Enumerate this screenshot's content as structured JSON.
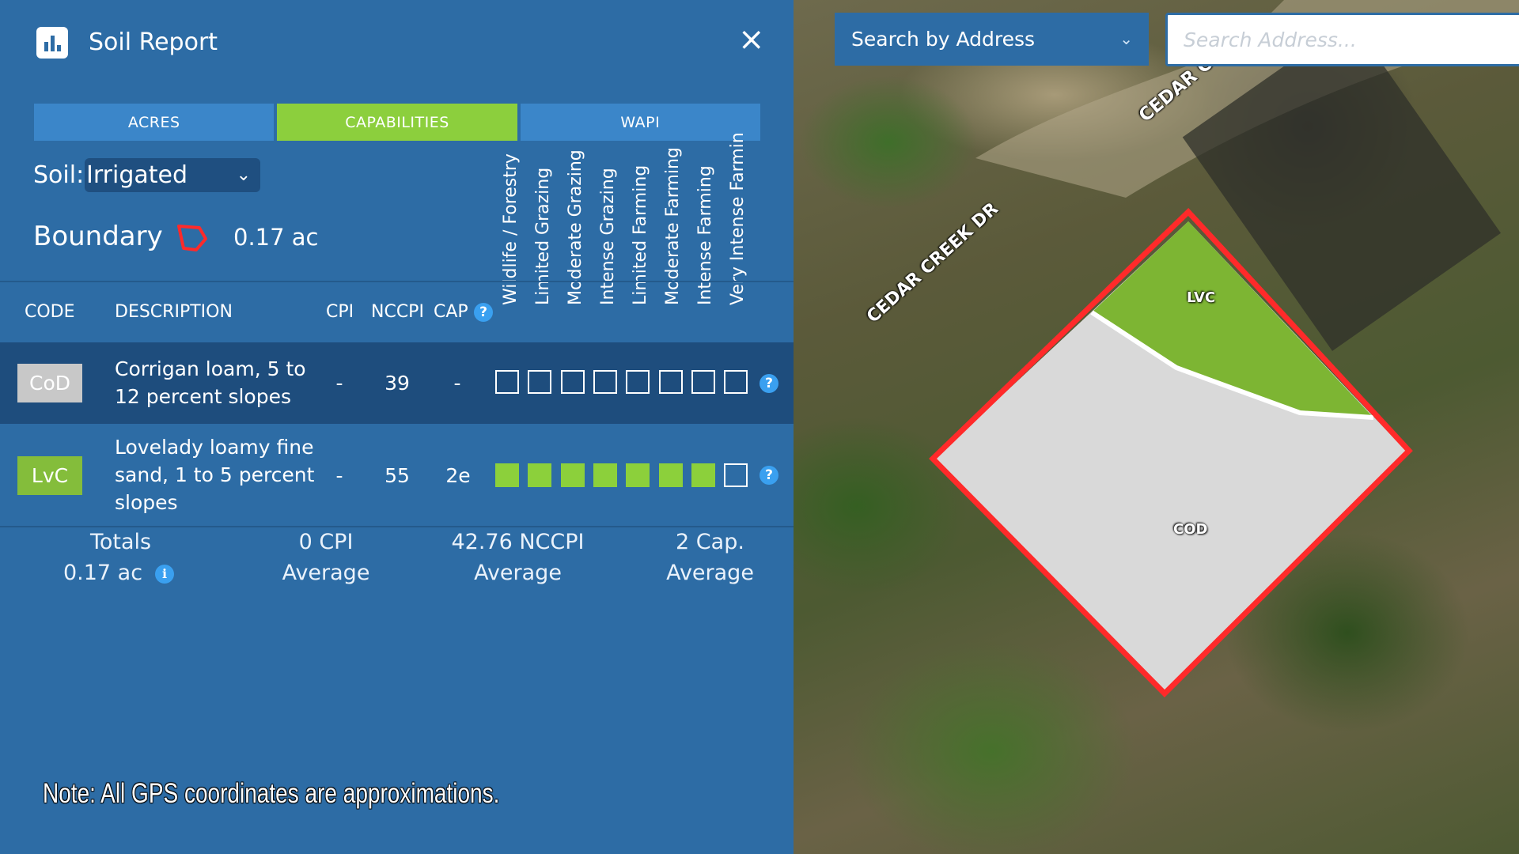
{
  "header": {
    "title": "Soil Report",
    "close_label": "×"
  },
  "tabs": [
    {
      "label": "ACRES",
      "active": false
    },
    {
      "label": "CAPABILITIES",
      "active": true
    },
    {
      "label": "WAPI",
      "active": false
    }
  ],
  "soil": {
    "label": "Soil:",
    "selected": "Irrigated"
  },
  "boundary": {
    "label": "Boundary",
    "value": "0.17 ac"
  },
  "capability_headers": [
    "Wildlife / Forestry",
    "Limited Grazing",
    "Moderate Grazing",
    "Intense Grazing",
    "Limited Farming",
    "Moderate Farming",
    "Intense Farming",
    "Very Intense Farmin"
  ],
  "table": {
    "columns": {
      "code": "CODE",
      "description": "DESCRIPTION",
      "cpi": "CPI",
      "nccpi": "NCCPI",
      "cap": "CAP"
    },
    "rows": [
      {
        "code": "CoD",
        "description": "Corrigan loam, 5 to 12 percent slopes",
        "cpi": "-",
        "nccpi": "39",
        "cap": "-",
        "boxes": [
          0,
          0,
          0,
          0,
          0,
          0,
          0,
          0
        ]
      },
      {
        "code": "LvC",
        "description": "Lovelady loamy fine sand, 1 to 5 percent slopes",
        "cpi": "-",
        "nccpi": "55",
        "cap": "2e",
        "boxes": [
          1,
          1,
          1,
          1,
          1,
          1,
          1,
          0
        ]
      }
    ]
  },
  "totals": {
    "label": "Totals",
    "acres": "0.17 ac",
    "cpi": "0 CPI",
    "cpi_sub": "Average",
    "nccpi": "42.76 NCCPI",
    "nccpi_sub": "Average",
    "cap": "2 Cap.",
    "cap_sub": "Average"
  },
  "note": "Note: All GPS coordinates are approximations.",
  "map": {
    "search_mode": "Search by Address",
    "search_placeholder": "Search Address...",
    "roads": [
      "CEDAR CR",
      "CEDAR CREEK DR"
    ],
    "parcel_labels": [
      "LVC",
      "COD"
    ]
  },
  "colors": {
    "panel": "#2d6ca5",
    "accent_green": "#8ccf3d",
    "boundary_red": "#ff2a2a"
  }
}
